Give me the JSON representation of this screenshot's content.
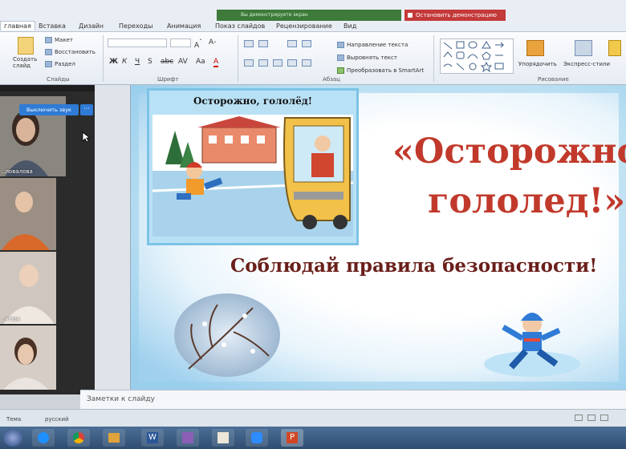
{
  "ribbon": {
    "tabs": [
      {
        "label": "главная",
        "active": true
      },
      {
        "label": "Вставка"
      },
      {
        "label": "Дизайн"
      },
      {
        "label": "Переходы"
      },
      {
        "label": "Анимация"
      },
      {
        "label": "Показ слайдов"
      },
      {
        "label": "Рецензирование"
      },
      {
        "label": "Вид"
      }
    ],
    "screen_share_notice": "Вы демонстрируете экран",
    "stop_share_label": "Остановить демонстрацию",
    "slides_group": {
      "new_slide": "Создать слайд",
      "layout": "Макет",
      "reset": "Восстановить",
      "section": "Раздел",
      "label": "Слайды"
    },
    "font_group_label": "Шрифт",
    "paragraph_group": {
      "text_direction": "Направление текста",
      "align_text": "Выровнять текст",
      "smartart": "Преобразовать в SmartArt",
      "label": "Абзац"
    },
    "drawing_group": {
      "arrange": "Упорядочить",
      "quick_styles": "Экспресс-стили",
      "label": "Рисование"
    }
  },
  "video_panel": {
    "mute_button": "Выключить звук",
    "more_button": "···",
    "participants": [
      {
        "name": "..ловалова"
      },
      {
        "name": ""
      },
      {
        "name": "..ктюк"
      },
      {
        "name": ""
      }
    ]
  },
  "slide": {
    "picture_caption": "Осторожно, гололёд!",
    "title_line1": "«Осторожно,",
    "title_line2": "гололед!»",
    "subtitle": "Соблюдай правила безопасности!"
  },
  "notes_placeholder": "Заметки к слайду",
  "status": {
    "theme": "Тема",
    "language": "русский"
  },
  "colors": {
    "title_red": "#c1392b",
    "subtitle_brown": "#6a1f1a",
    "stop_red": "#c4393a",
    "notice_green": "#3e7a3a",
    "mute_blue": "#2f7bd6"
  }
}
